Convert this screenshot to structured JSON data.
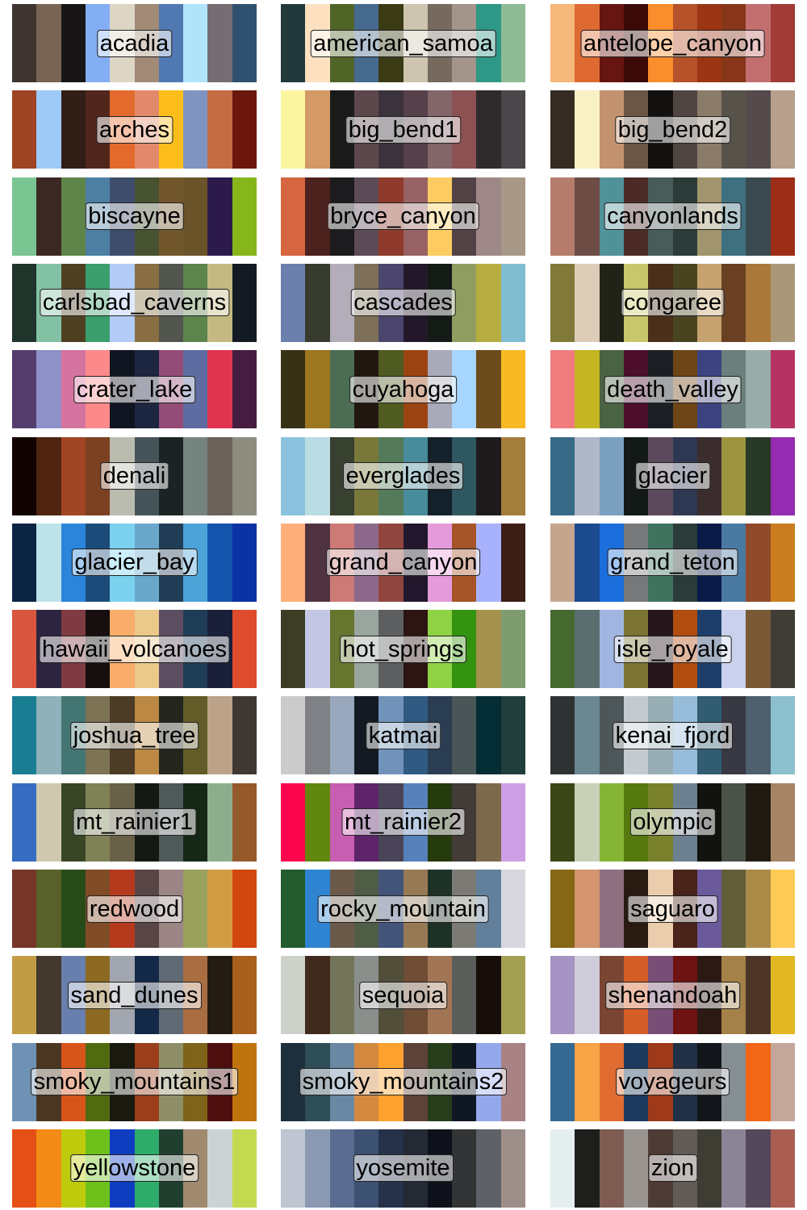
{
  "chart_data": {
    "type": "palette-grid",
    "palettes": [
      {
        "name": "acadia",
        "colors": [
          "#3F3430",
          "#776455",
          "#181517",
          "#84AEF3",
          "#DDD6C5",
          "#A18A76",
          "#5078B2",
          "#B1E4FA",
          "#756D74",
          "#30506F"
        ]
      },
      {
        "name": "american_samoa",
        "colors": [
          "#22393C",
          "#FCE0C0",
          "#506427",
          "#456A8E",
          "#3A3A14",
          "#CEC5B0",
          "#766A5E",
          "#A3948C",
          "#2F9786",
          "#8FBB97"
        ]
      },
      {
        "name": "antelope_canyon",
        "colors": [
          "#F6B77A",
          "#DE6A31",
          "#661510",
          "#3B0A08",
          "#FA8D2C",
          "#B55229",
          "#9B3514",
          "#87361A",
          "#C36F6F",
          "#A03B35"
        ]
      },
      {
        "name": "arches",
        "colors": [
          "#9F4325",
          "#9DCAF6",
          "#311E16",
          "#51261C",
          "#E36A2C",
          "#E2896C",
          "#FDBE1B",
          "#7F94C0",
          "#C56C44",
          "#6B170C"
        ]
      },
      {
        "name": "big_bend1",
        "colors": [
          "#FAF59E",
          "#D39967",
          "#1A1A1A",
          "#5C474C",
          "#3B333B",
          "#564049",
          "#826669",
          "#8C5152",
          "#2F2A2C",
          "#4A464A"
        ]
      },
      {
        "name": "big_bend2",
        "colors": [
          "#342B22",
          "#FAF0C6",
          "#C3926F",
          "#6B5646",
          "#12110F",
          "#4E4540",
          "#8B7B69",
          "#58534A",
          "#554B4D",
          "#B69F8D"
        ]
      },
      {
        "name": "biscayne",
        "colors": [
          "#7BC592",
          "#3C2823",
          "#5F844A",
          "#4C7FA2",
          "#3F4D6C",
          "#475230",
          "#71562C",
          "#6A5329",
          "#2C1A4D",
          "#87B61C"
        ]
      },
      {
        "name": "bryce_canyon",
        "colors": [
          "#D5663F",
          "#4C221E",
          "#1C1B1D",
          "#5D4A57",
          "#8E3A2C",
          "#976263",
          "#FCCC63",
          "#534245",
          "#9E8888",
          "#A89887"
        ]
      },
      {
        "name": "canyonlands",
        "colors": [
          "#B67D6D",
          "#6D4C45",
          "#509298",
          "#4C2B27",
          "#485C5A",
          "#2B3B38",
          "#A0956C",
          "#3E7080",
          "#3B4A51",
          "#9C2E17"
        ]
      },
      {
        "name": "carlsbad_caverns",
        "colors": [
          "#1F342B",
          "#82C1A3",
          "#504022",
          "#3A9E6D",
          "#B2CBF7",
          "#886E42",
          "#52554E",
          "#5D844C",
          "#C5B982",
          "#141A24"
        ]
      },
      {
        "name": "cascades",
        "colors": [
          "#6C80AE",
          "#363B2D",
          "#B2ADB8",
          "#7E7058",
          "#4C466E",
          "#23182A",
          "#141A16",
          "#909D61",
          "#B7AE41",
          "#81BDD0"
        ]
      },
      {
        "name": "congaree",
        "colors": [
          "#817938",
          "#DDCCB7",
          "#202315",
          "#C8C76B",
          "#4A2F1A",
          "#484420",
          "#C5A26E",
          "#6A4022",
          "#A9783A",
          "#A99779"
        ]
      },
      {
        "name": "crater_lake",
        "colors": [
          "#533D6C",
          "#8E91C8",
          "#D5739F",
          "#FD8A8B",
          "#101521",
          "#1C2641",
          "#924C76",
          "#5E6CA1",
          "#E0344E",
          "#451D40"
        ]
      },
      {
        "name": "cuyahoga",
        "colors": [
          "#373116",
          "#9D7620",
          "#4C6C53",
          "#221710",
          "#4F5B21",
          "#9C4411",
          "#A8A9B9",
          "#A6D5FD",
          "#6C4C1C",
          "#F7B923"
        ]
      },
      {
        "name": "death_valley",
        "colors": [
          "#F07C7E",
          "#C4B522",
          "#4A6342",
          "#4C0E2B",
          "#1B1F23",
          "#6D4516",
          "#3D4381",
          "#6B7F7C",
          "#99ACA9",
          "#B53363"
        ]
      },
      {
        "name": "denali",
        "colors": [
          "#120201",
          "#4F2511",
          "#A14624",
          "#7B4122",
          "#BBBCB0",
          "#455458",
          "#1B2325",
          "#768480",
          "#6B6259",
          "#8E8D7F"
        ]
      },
      {
        "name": "everglades",
        "colors": [
          "#8BC3DE",
          "#BADDE3",
          "#384030",
          "#7A7838",
          "#547A5A",
          "#488B9A",
          "#13212B",
          "#2F5760",
          "#1C1A1A",
          "#A37E3C"
        ]
      },
      {
        "name": "glacier",
        "colors": [
          "#386A88",
          "#B0B7C8",
          "#7CA0C0",
          "#131917",
          "#5D4A5D",
          "#2F3852",
          "#3B2D2D",
          "#9D9440",
          "#283829",
          "#932CB0"
        ]
      },
      {
        "name": "glacier_bay",
        "colors": [
          "#0B2544",
          "#BCE2EA",
          "#2A85DB",
          "#1C4B7A",
          "#7BD1EE",
          "#6AA7CB",
          "#213D56",
          "#4CA3D8",
          "#1454AD",
          "#0B33A5"
        ]
      },
      {
        "name": "grand_canyon",
        "colors": [
          "#FEAF79",
          "#503340",
          "#CD7A76",
          "#8C698A",
          "#91453F",
          "#22172C",
          "#E59BDA",
          "#A65429",
          "#A8B2FC",
          "#3D1E16"
        ]
      },
      {
        "name": "grand_teton",
        "colors": [
          "#C4A58E",
          "#1B4A8E",
          "#1B6EDB",
          "#76787A",
          "#40735F",
          "#2B3B3A",
          "#0B1B48",
          "#4A79A1",
          "#904A2B",
          "#CA7D1E"
        ]
      },
      {
        "name": "hawaii_volcanoes",
        "colors": [
          "#D9573E",
          "#2D2440",
          "#7F3B41",
          "#170F0F",
          "#F9AD6A",
          "#EAC98A",
          "#5C4D60",
          "#1F3D56",
          "#1A1F3A",
          "#DF4C2D"
        ]
      },
      {
        "name": "hot_springs",
        "colors": [
          "#3D3D26",
          "#C3C7E3",
          "#66762F",
          "#9BA59F",
          "#5E5F60",
          "#2D1513",
          "#8FD244",
          "#34930F",
          "#A4914C",
          "#7E9C70"
        ]
      },
      {
        "name": "isle_royale",
        "colors": [
          "#466930",
          "#5A6D6F",
          "#A0B5E0",
          "#7B7433",
          "#24161A",
          "#B14D11",
          "#1D3E6A",
          "#C9D1EC",
          "#7A5937",
          "#403D37"
        ]
      },
      {
        "name": "joshua_tree",
        "colors": [
          "#1A7E92",
          "#8FB2BA",
          "#437673",
          "#7D7355",
          "#4C3C25",
          "#BB8944",
          "#24251C",
          "#635C29",
          "#BCA288",
          "#3F3832"
        ]
      },
      {
        "name": "katmai",
        "colors": [
          "#CBCBCB",
          "#7F8186",
          "#98A7BC",
          "#131A22",
          "#7193BA",
          "#305A82",
          "#2B3D53",
          "#495556",
          "#052D35",
          "#213D3C"
        ]
      },
      {
        "name": "kenai_fjord",
        "colors": [
          "#2F3232",
          "#6A8792",
          "#4D5658",
          "#C3CBD1",
          "#98AEB4",
          "#97BCDA",
          "#315C72",
          "#383843",
          "#4E5F6D",
          "#8CC0CE"
        ]
      },
      {
        "name": "mt_rainier1",
        "colors": [
          "#366DC0",
          "#D0C8AF",
          "#394626",
          "#7E8256",
          "#696048",
          "#141A13",
          "#4E5A5A",
          "#152716",
          "#8DAE8C",
          "#955A2C"
        ]
      },
      {
        "name": "mt_rainier2",
        "colors": [
          "#FA054E",
          "#62870F",
          "#C75EB0",
          "#5E246A",
          "#4A4458",
          "#5781BB",
          "#253A0D",
          "#423B38",
          "#7D6A4C",
          "#CE9FE5"
        ]
      },
      {
        "name": "olympic",
        "colors": [
          "#3B4616",
          "#C8D0B7",
          "#86B535",
          "#56790E",
          "#79812C",
          "#6D8090",
          "#12120E",
          "#4B5247",
          "#1F1A11",
          "#A68465"
        ]
      },
      {
        "name": "redwood",
        "colors": [
          "#773528",
          "#576129",
          "#284B1A",
          "#804C27",
          "#B53A1D",
          "#584546",
          "#9C8585",
          "#9AA15D",
          "#D29C45",
          "#D24710"
        ]
      },
      {
        "name": "rocky_mountain",
        "colors": [
          "#235B2C",
          "#2E84D1",
          "#6B5A4A",
          "#4F5C46",
          "#43547A",
          "#977A55",
          "#1E3126",
          "#7C7A74",
          "#62809B",
          "#D8D7DE"
        ]
      },
      {
        "name": "saguaro",
        "colors": [
          "#856715",
          "#D3946E",
          "#8D6F80",
          "#291B12",
          "#EACDAD",
          "#4A231A",
          "#6B5A9B",
          "#625E39",
          "#AC8B49",
          "#FDCA54"
        ]
      },
      {
        "name": "sand_dunes",
        "colors": [
          "#C29C45",
          "#42382D",
          "#687EAC",
          "#8D6A22",
          "#A1A6AF",
          "#142848",
          "#5F6A75",
          "#A96D42",
          "#241B12",
          "#A7601D"
        ]
      },
      {
        "name": "sequoia",
        "colors": [
          "#CCD1CA",
          "#40291D",
          "#727559",
          "#8B8F8C",
          "#514E3A",
          "#6F4C34",
          "#A27555",
          "#5A5D59",
          "#170E0A",
          "#A4A053"
        ]
      },
      {
        "name": "shenandoah",
        "colors": [
          "#A493C3",
          "#D0CDDA",
          "#7A4533",
          "#D55D28",
          "#794E76",
          "#6D1311",
          "#2C1914",
          "#A48148",
          "#4D3528",
          "#E1B822"
        ]
      },
      {
        "name": "smoky_mountains1",
        "colors": [
          "#6F92B4",
          "#4B3721",
          "#D6541A",
          "#516A10",
          "#19190F",
          "#9A3E1B",
          "#8E8F66",
          "#7E6318",
          "#4E0F0F",
          "#C0740E"
        ]
      },
      {
        "name": "smoky_mountains2",
        "colors": [
          "#1E2F3C",
          "#2D4D57",
          "#6A87A3",
          "#D38A40",
          "#FEA12F",
          "#5D4239",
          "#273D1C",
          "#0F1822",
          "#94A9EB",
          "#A88284"
        ]
      },
      {
        "name": "voyageurs",
        "colors": [
          "#356A93",
          "#F9A347",
          "#E16C31",
          "#1B3A5D",
          "#9E3A19",
          "#213045",
          "#12151A",
          "#868F93",
          "#F26618",
          "#C3A79A"
        ]
      },
      {
        "name": "yellowstone",
        "colors": [
          "#E55016",
          "#F28C17",
          "#BECB0D",
          "#6EC11B",
          "#0E3DC1",
          "#2EAC6A",
          "#213F2E",
          "#A08A6F",
          "#CCD3D4",
          "#C3D94F"
        ]
      },
      {
        "name": "yosemite",
        "colors": [
          "#BFC6D1",
          "#8B99B2",
          "#5A6D90",
          "#3D5172",
          "#263249",
          "#232A34",
          "#0E111A",
          "#333435",
          "#5E6168",
          "#9D8E89"
        ]
      },
      {
        "name": "zion",
        "colors": [
          "#E5EEEE",
          "#1E1F1C",
          "#7E5C52",
          "#999490",
          "#4D3B36",
          "#635B55",
          "#3D3D33",
          "#8B8496",
          "#53495A",
          "#A95E51"
        ]
      }
    ]
  }
}
